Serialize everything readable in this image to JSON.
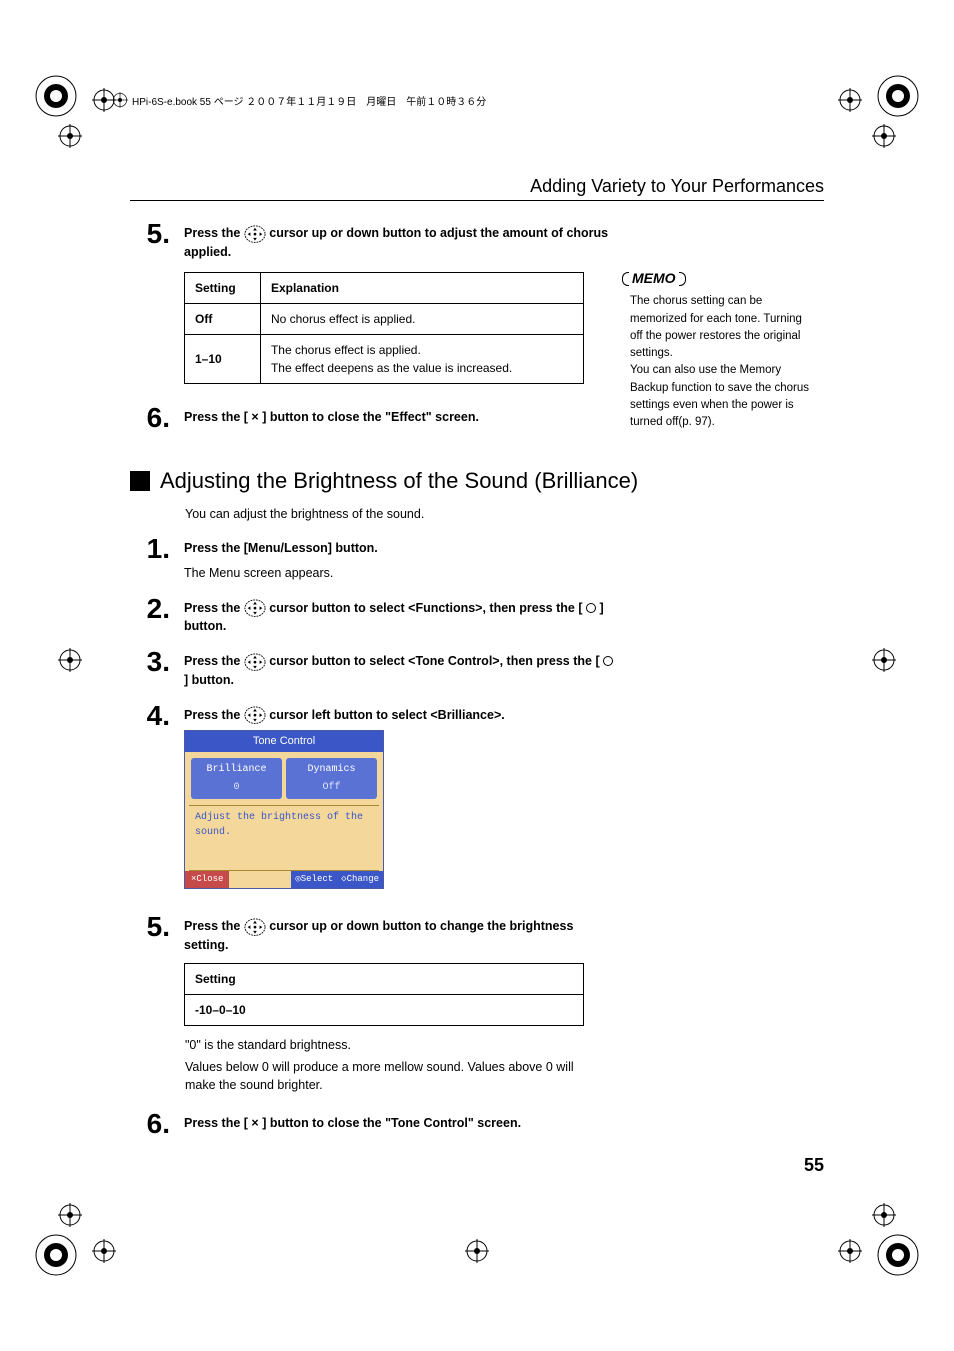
{
  "header_note": "HPi-6S-e.book  55 ページ ２００７年１１月１９日　月曜日　午前１０時３６分",
  "section_title": "Adding Variety to Your Performances",
  "step5a": {
    "num": "5.",
    "pre": "Press the",
    "post": "cursor up or down button to adjust the amount of chorus applied."
  },
  "table_chorus": {
    "head": [
      "Setting",
      "Explanation"
    ],
    "rows": [
      [
        "Off",
        "No chorus effect is applied."
      ],
      [
        "1–10",
        "The chorus effect is applied.\nThe effect deepens as the value is increased."
      ]
    ]
  },
  "step6a": {
    "num": "6.",
    "pre": "Press the [",
    "mid": "×",
    "post": "] button to close the \"Effect\" screen."
  },
  "memo": {
    "label": "MEMO",
    "text": "The chorus setting can be memorized for each tone. Turning off the power restores the original settings.\nYou can also use the Memory Backup function to save the chorus settings even when the power is turned off(p. 97)."
  },
  "subhead": "Adjusting the Brightness of the Sound (Brilliance)",
  "subtext": "You can adjust the brightness of the sound.",
  "step1b": {
    "num": "1.",
    "bold": "Press the [Menu/Lesson] button.",
    "plain": "The Menu screen appears."
  },
  "step2b": {
    "num": "2.",
    "pre": "Press the",
    "mid1": "cursor button to select <Functions>, then press the [",
    "post": "] button."
  },
  "step3b": {
    "num": "3.",
    "pre": "Press the",
    "mid1": "cursor button to select <Tone Control>, then press the [",
    "post": "] button."
  },
  "step4b": {
    "num": "4.",
    "pre": "Press the",
    "post": "cursor left button to select <Brilliance>."
  },
  "screenshot": {
    "title": "Tone Control",
    "tab1": "Brilliance",
    "tab1v": "0",
    "tab2": "Dynamics",
    "tab2v": "Off",
    "desc": "Adjust the brightness of the sound.",
    "close": "×Close",
    "select": "◎Select",
    "change": "◇Change"
  },
  "step5b": {
    "num": "5.",
    "pre": "Press the",
    "post": "cursor up or down button to change the brightness setting."
  },
  "table_bright": {
    "head": "Setting",
    "row": "-10–0–10"
  },
  "note1": "\"0\" is the standard brightness.",
  "note2": "Values below 0 will produce a more mellow sound. Values above 0 will make the sound brighter.",
  "step6b": {
    "num": "6.",
    "pre": "Press the [",
    "mid": "×",
    "post": "] button to close the \"Tone Control\" screen."
  },
  "page_num": "55"
}
